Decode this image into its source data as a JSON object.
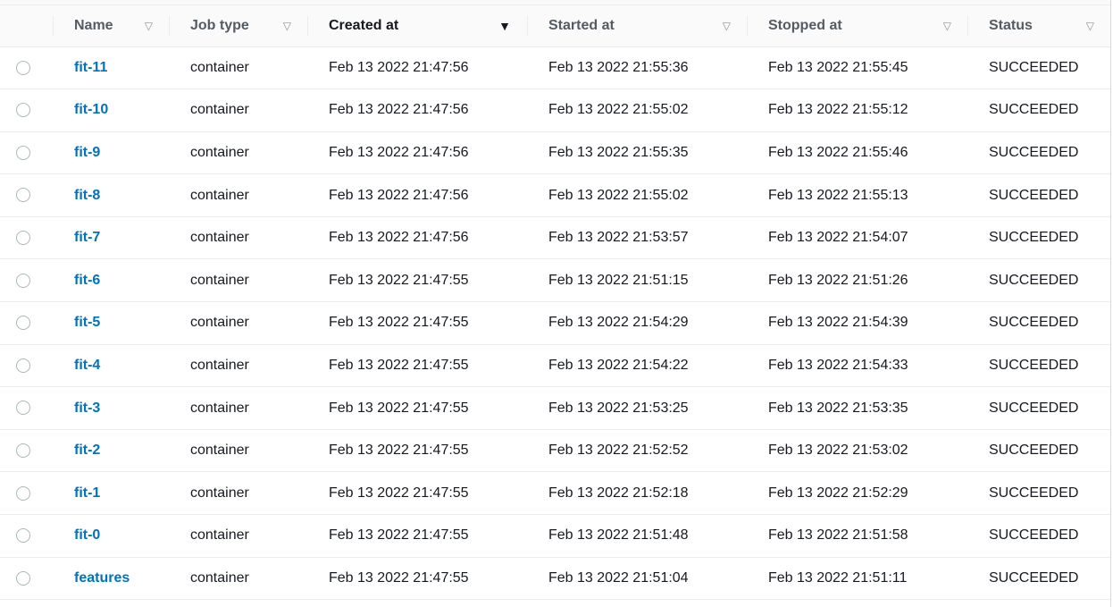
{
  "table": {
    "columns": [
      {
        "key": "select",
        "label": ""
      },
      {
        "key": "name",
        "label": "Name",
        "sort_icon": "▽",
        "sorted": false
      },
      {
        "key": "job_type",
        "label": "Job type",
        "sort_icon": "▽",
        "sorted": false
      },
      {
        "key": "created_at",
        "label": "Created at",
        "sort_icon": "▼",
        "sorted": true,
        "sort_direction": "descending"
      },
      {
        "key": "started_at",
        "label": "Started at",
        "sort_icon": "▽",
        "sorted": false
      },
      {
        "key": "stopped_at",
        "label": "Stopped at",
        "sort_icon": "▽",
        "sorted": false
      },
      {
        "key": "status",
        "label": "Status",
        "sort_icon": "▽",
        "sorted": false
      }
    ],
    "rows": [
      {
        "name": "fit-11",
        "job_type": "container",
        "created_at": "Feb 13 2022 21:47:56",
        "started_at": "Feb 13 2022 21:55:36",
        "stopped_at": "Feb 13 2022 21:55:45",
        "status": "SUCCEEDED",
        "selected": false
      },
      {
        "name": "fit-10",
        "job_type": "container",
        "created_at": "Feb 13 2022 21:47:56",
        "started_at": "Feb 13 2022 21:55:02",
        "stopped_at": "Feb 13 2022 21:55:12",
        "status": "SUCCEEDED",
        "selected": false
      },
      {
        "name": "fit-9",
        "job_type": "container",
        "created_at": "Feb 13 2022 21:47:56",
        "started_at": "Feb 13 2022 21:55:35",
        "stopped_at": "Feb 13 2022 21:55:46",
        "status": "SUCCEEDED",
        "selected": false
      },
      {
        "name": "fit-8",
        "job_type": "container",
        "created_at": "Feb 13 2022 21:47:56",
        "started_at": "Feb 13 2022 21:55:02",
        "stopped_at": "Feb 13 2022 21:55:13",
        "status": "SUCCEEDED",
        "selected": false
      },
      {
        "name": "fit-7",
        "job_type": "container",
        "created_at": "Feb 13 2022 21:47:56",
        "started_at": "Feb 13 2022 21:53:57",
        "stopped_at": "Feb 13 2022 21:54:07",
        "status": "SUCCEEDED",
        "selected": false
      },
      {
        "name": "fit-6",
        "job_type": "container",
        "created_at": "Feb 13 2022 21:47:55",
        "started_at": "Feb 13 2022 21:51:15",
        "stopped_at": "Feb 13 2022 21:51:26",
        "status": "SUCCEEDED",
        "selected": false
      },
      {
        "name": "fit-5",
        "job_type": "container",
        "created_at": "Feb 13 2022 21:47:55",
        "started_at": "Feb 13 2022 21:54:29",
        "stopped_at": "Feb 13 2022 21:54:39",
        "status": "SUCCEEDED",
        "selected": false
      },
      {
        "name": "fit-4",
        "job_type": "container",
        "created_at": "Feb 13 2022 21:47:55",
        "started_at": "Feb 13 2022 21:54:22",
        "stopped_at": "Feb 13 2022 21:54:33",
        "status": "SUCCEEDED",
        "selected": false
      },
      {
        "name": "fit-3",
        "job_type": "container",
        "created_at": "Feb 13 2022 21:47:55",
        "started_at": "Feb 13 2022 21:53:25",
        "stopped_at": "Feb 13 2022 21:53:35",
        "status": "SUCCEEDED",
        "selected": false
      },
      {
        "name": "fit-2",
        "job_type": "container",
        "created_at": "Feb 13 2022 21:47:55",
        "started_at": "Feb 13 2022 21:52:52",
        "stopped_at": "Feb 13 2022 21:53:02",
        "status": "SUCCEEDED",
        "selected": false
      },
      {
        "name": "fit-1",
        "job_type": "container",
        "created_at": "Feb 13 2022 21:47:55",
        "started_at": "Feb 13 2022 21:52:18",
        "stopped_at": "Feb 13 2022 21:52:29",
        "status": "SUCCEEDED",
        "selected": false
      },
      {
        "name": "fit-0",
        "job_type": "container",
        "created_at": "Feb 13 2022 21:47:55",
        "started_at": "Feb 13 2022 21:51:48",
        "stopped_at": "Feb 13 2022 21:51:58",
        "status": "SUCCEEDED",
        "selected": false
      },
      {
        "name": "features",
        "job_type": "container",
        "created_at": "Feb 13 2022 21:47:55",
        "started_at": "Feb 13 2022 21:51:04",
        "stopped_at": "Feb 13 2022 21:51:11",
        "status": "SUCCEEDED",
        "selected": false
      }
    ]
  },
  "colors": {
    "link": "#0073bb",
    "header_bg": "#fafafa",
    "border": "#eaeded",
    "text": "#16191f",
    "header_text": "#545b64",
    "sort_icon": "#879596"
  }
}
